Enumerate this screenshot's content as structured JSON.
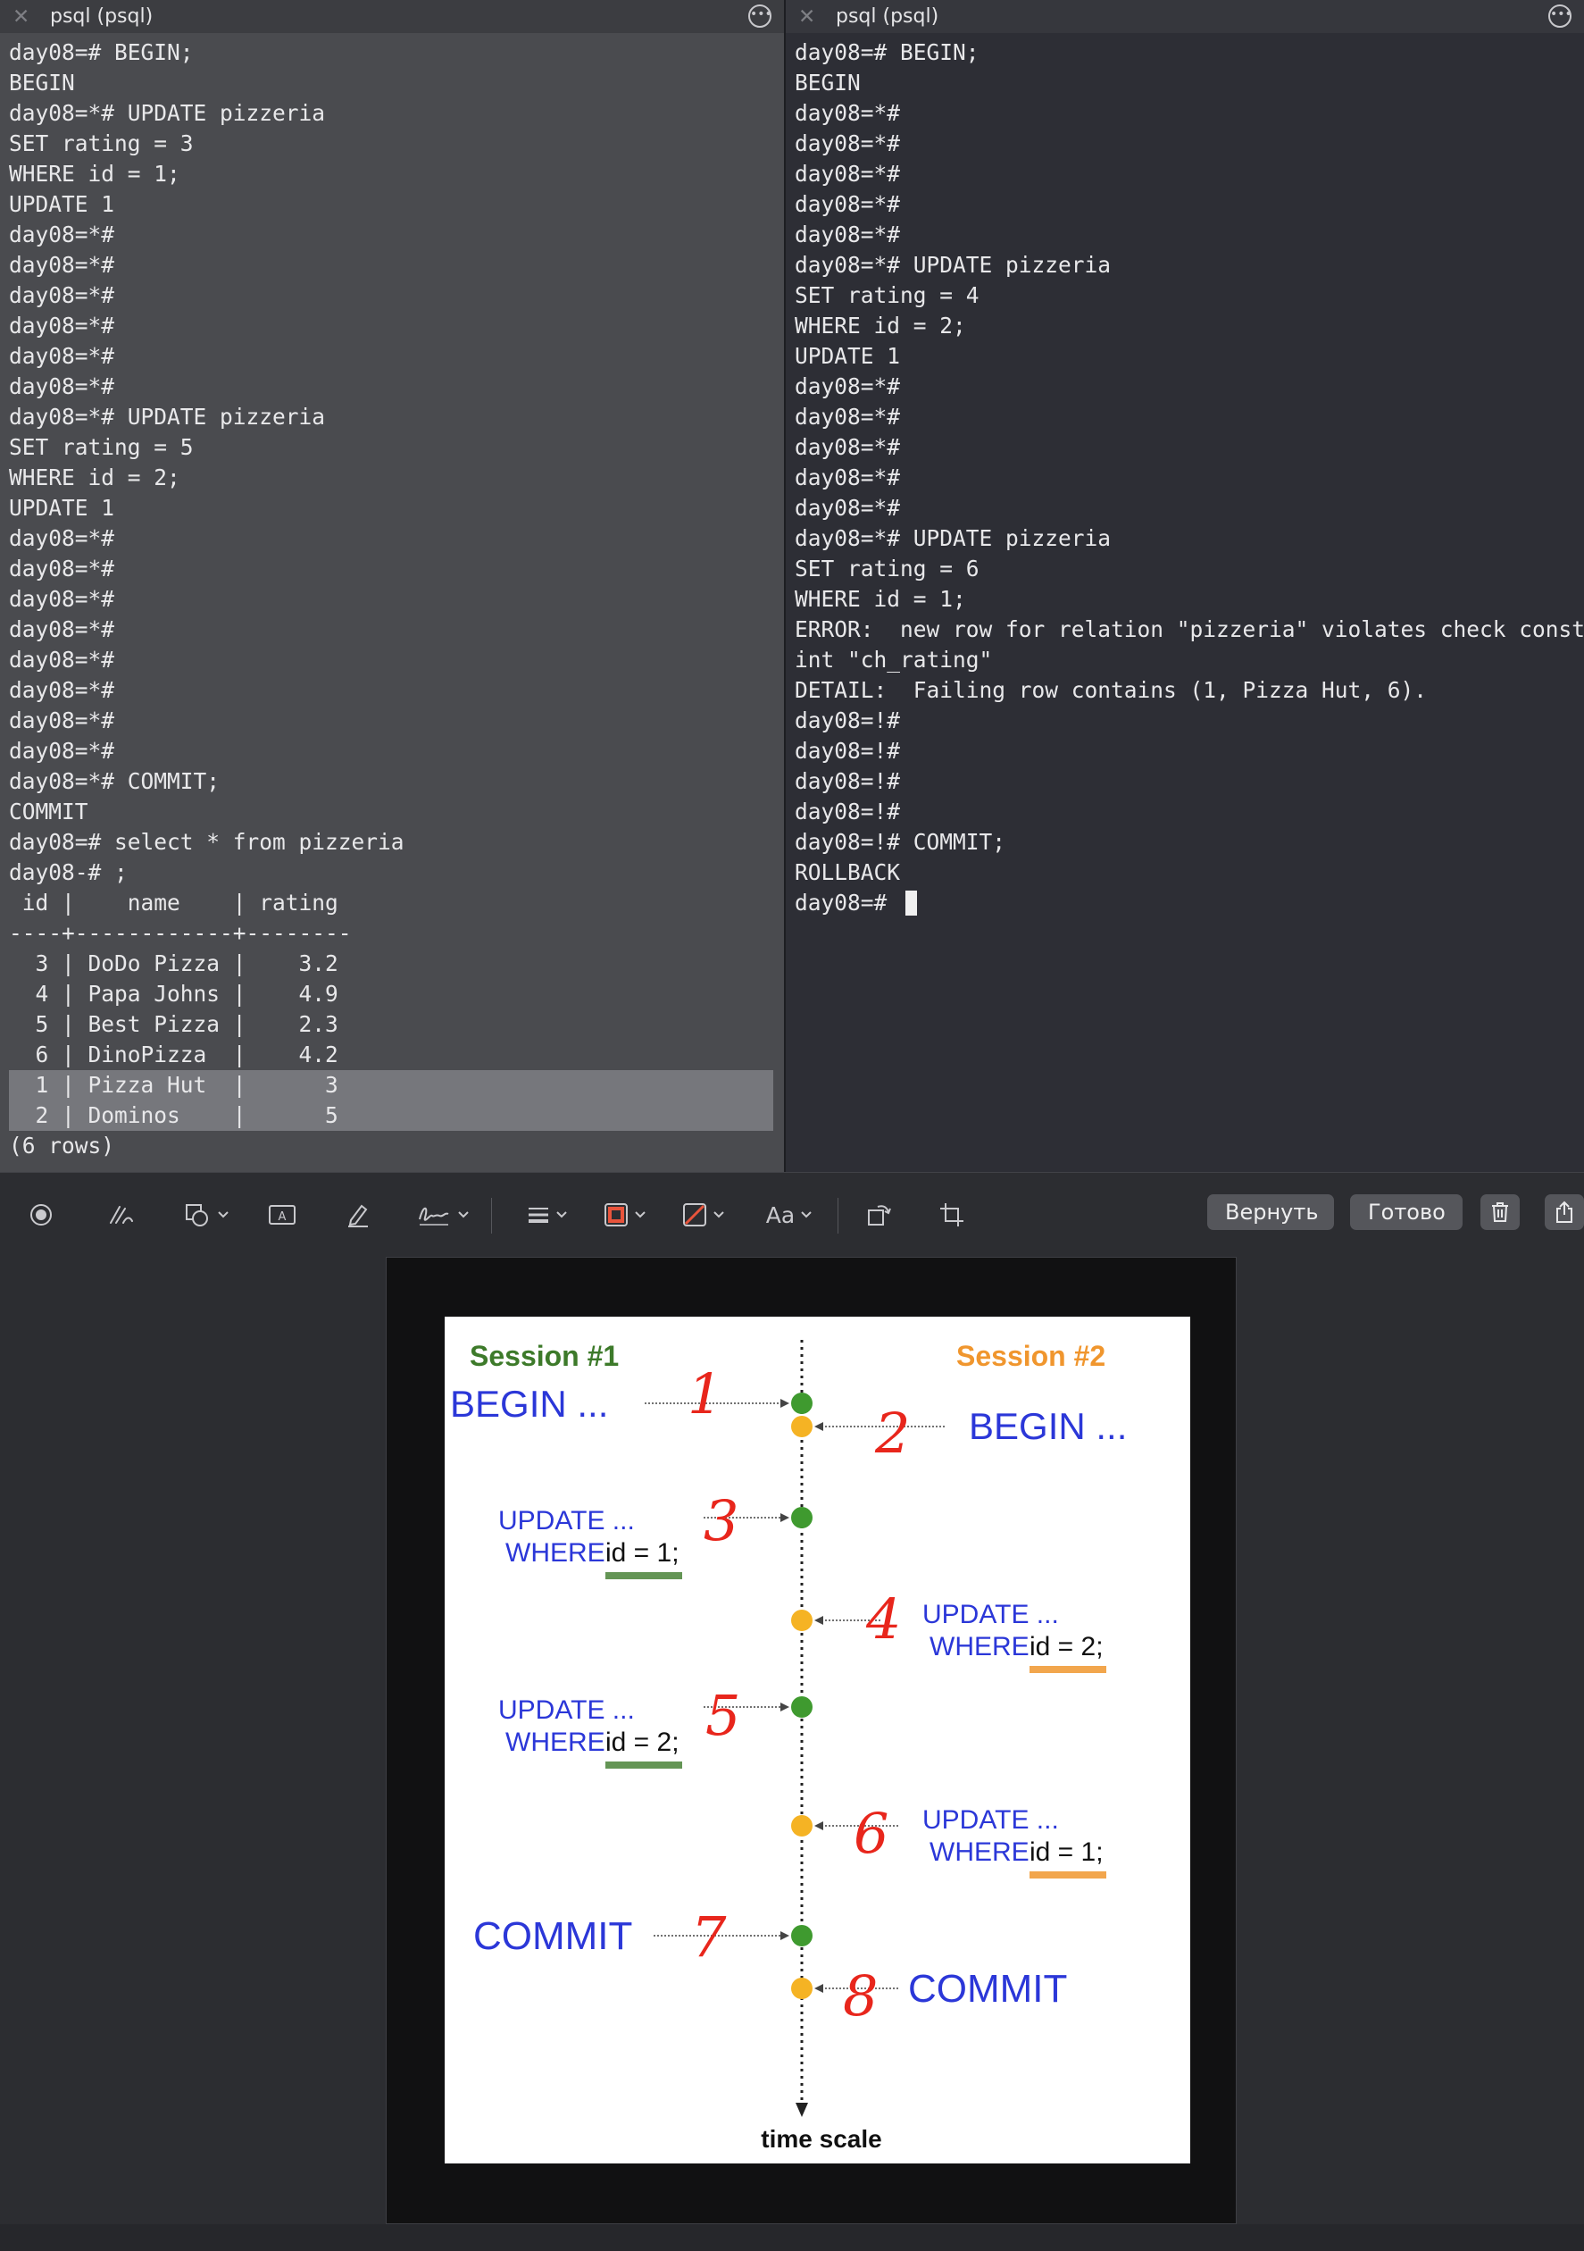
{
  "left_terminal": {
    "title": "psql (psql)",
    "lines": [
      "day08=# BEGIN;",
      "BEGIN",
      "day08=*# UPDATE pizzeria",
      "SET rating = 3",
      "WHERE id = 1;",
      "UPDATE 1",
      "day08=*#",
      "day08=*#",
      "day08=*#",
      "day08=*#",
      "day08=*#",
      "day08=*#",
      "day08=*# UPDATE pizzeria",
      "SET rating = 5",
      "WHERE id = 2;",
      "UPDATE 1",
      "day08=*#",
      "day08=*#",
      "day08=*#",
      "day08=*#",
      "day08=*#",
      "day08=*#",
      "day08=*#",
      "day08=*#",
      "day08=*# COMMIT;",
      "COMMIT",
      "day08=# select * from pizzeria",
      "day08-# ;",
      " id |    name    | rating",
      "----+------------+--------",
      "  3 | DoDo Pizza |    3.2",
      "  4 | Papa Johns |    4.9",
      "  5 | Best Pizza |    2.3",
      "  6 | DinoPizza  |    4.2",
      "  1 | Pizza Hut  |      3",
      "  2 | Dominos    |      5",
      "(6 rows)"
    ]
  },
  "right_terminal": {
    "title": "psql (psql)",
    "lines": [
      "day08=# BEGIN;",
      "BEGIN",
      "day08=*#",
      "day08=*#",
      "day08=*#",
      "day08=*#",
      "day08=*#",
      "day08=*# UPDATE pizzeria",
      "SET rating = 4",
      "WHERE id = 2;",
      "UPDATE 1",
      "day08=*#",
      "day08=*#",
      "day08=*#",
      "day08=*#",
      "day08=*#",
      "day08=*# UPDATE pizzeria",
      "SET rating = 6",
      "WHERE id = 1;",
      "ERROR:  new row for relation \"pizzeria\" violates check constra",
      "int \"ch_rating\"",
      "DETAIL:  Failing row contains (1, Pizza Hut, 6).",
      "day08=!#",
      "day08=!#",
      "day08=!#",
      "day08=!#",
      "day08=!# COMMIT;",
      "ROLLBACK"
    ],
    "prompt": "day08=# "
  },
  "toolbar": {
    "revert_label": "Вернуть",
    "done_label": "Готово",
    "font_label": "Aa",
    "icons": [
      "record-icon",
      "sketch-icon",
      "shapes-icon",
      "text-box-icon",
      "highlight-icon",
      "signature-icon",
      "line-style-icon",
      "border-color-icon",
      "fill-color-icon",
      "font-icon",
      "rotate-icon",
      "crop-icon",
      "trash-icon",
      "share-icon"
    ],
    "border_color": "#e8543c",
    "fill_color": "#e8543c"
  },
  "diagram": {
    "session1_label": "Session #1",
    "session2_label": "Session #2",
    "session1_color": "#3d7a2a",
    "session2_color": "#f0962e",
    "text_color": "#2b37d8",
    "annotation_color": "#e8261c",
    "s1_begin": "BEGIN ...",
    "s2_begin": "BEGIN ...",
    "s1_update1_a": "UPDATE ...",
    "s1_update1_b": "WHERE",
    "s1_update1_c": "id = 1;",
    "s2_update1_a": "UPDATE ...",
    "s2_update1_b": "WHERE",
    "s2_update1_c": "id = 2;",
    "s1_update2_a": "UPDATE ...",
    "s1_update2_b": "WHERE",
    "s1_update2_c": "id = 2;",
    "s2_update2_a": "UPDATE ...",
    "s2_update2_b": "WHERE",
    "s2_update2_c": "id = 1;",
    "s1_commit": "COMMIT",
    "s2_commit": "COMMIT",
    "time_label": "time scale",
    "step_numbers": [
      "1",
      "2",
      "3",
      "4",
      "5",
      "6",
      "7",
      "8"
    ]
  }
}
